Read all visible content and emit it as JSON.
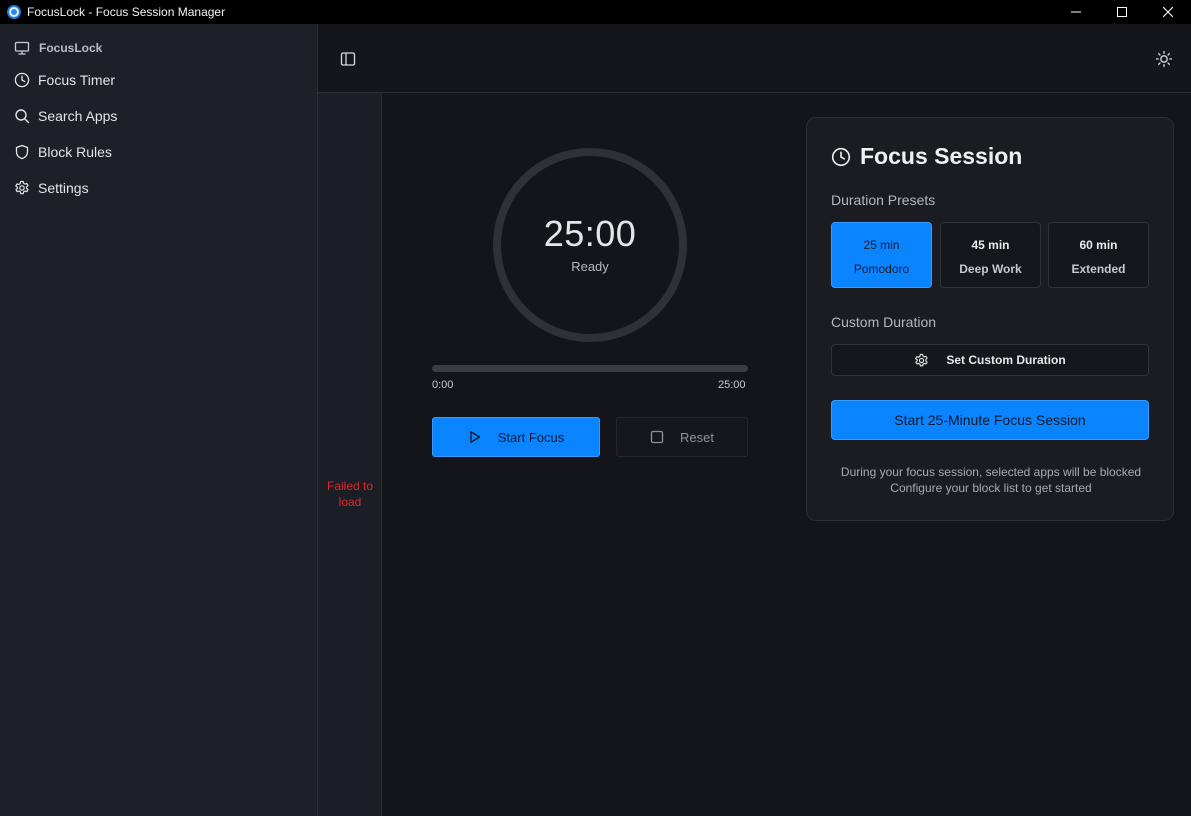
{
  "window": {
    "title": "FocusLock - Focus Session Manager",
    "controls": {
      "minimize": "minimize-icon",
      "maximize": "maximize-icon",
      "close": "close-icon"
    }
  },
  "sidebar": {
    "brand": "FocusLock",
    "items": [
      {
        "label": "Focus Timer",
        "icon": "clock-icon"
      },
      {
        "label": "Search Apps",
        "icon": "search-icon"
      },
      {
        "label": "Block Rules",
        "icon": "shield-icon"
      },
      {
        "label": "Settings",
        "icon": "gear-icon"
      }
    ]
  },
  "side_pane": {
    "error": "Failed to load"
  },
  "timer": {
    "value": "25:00",
    "status": "Ready",
    "progress": 0,
    "start_label": "0:00",
    "end_label": "25:00",
    "start_button": "Start Focus",
    "reset_button": "Reset"
  },
  "session": {
    "title": "Focus Session",
    "presets_label": "Duration Presets",
    "presets": [
      {
        "time": "25 min",
        "name": "Pomodoro",
        "active": true
      },
      {
        "time": "45 min",
        "name": "Deep Work",
        "active": false
      },
      {
        "time": "60 min",
        "name": "Extended",
        "active": false
      }
    ],
    "custom_label": "Custom Duration",
    "custom_button": "Set Custom Duration",
    "start_button": "Start 25-Minute Focus Session",
    "note_line1": "During your focus session, selected apps will be blocked",
    "note_line2": "Configure your block list to get started"
  },
  "colors": {
    "accent": "#0a84ff",
    "error": "#e0262e",
    "sidebar_bg": "#1d2027",
    "main_bg": "#13151a"
  }
}
